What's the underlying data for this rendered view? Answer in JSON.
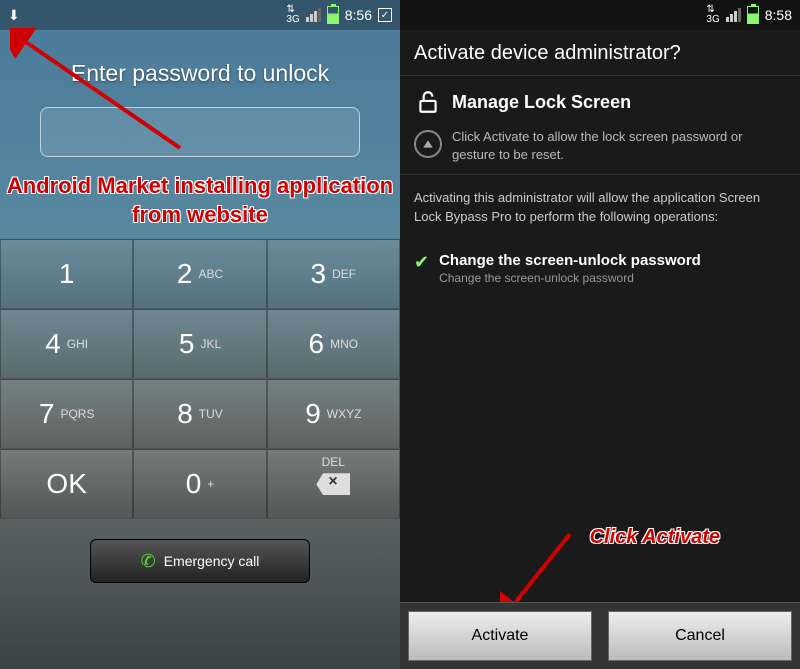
{
  "left": {
    "status": {
      "time": "8:56",
      "network": "3G"
    },
    "prompt": "Enter password to unlock",
    "annotation": "Android Market installing application from website",
    "keys": [
      {
        "n": "1",
        "l": ""
      },
      {
        "n": "2",
        "l": "ABC"
      },
      {
        "n": "3",
        "l": "DEF"
      },
      {
        "n": "4",
        "l": "GHI"
      },
      {
        "n": "5",
        "l": "JKL"
      },
      {
        "n": "6",
        "l": "MNO"
      },
      {
        "n": "7",
        "l": "PQRS"
      },
      {
        "n": "8",
        "l": "TUV"
      },
      {
        "n": "9",
        "l": "WXYZ"
      },
      {
        "n": "OK",
        "l": ""
      },
      {
        "n": "0",
        "l": "+"
      },
      {
        "n": "",
        "l": "DEL",
        "del": true
      }
    ],
    "emergency": "Emergency call"
  },
  "right": {
    "status": {
      "time": "8:58",
      "network": "3G"
    },
    "title": "Activate device administrator?",
    "app_name": "Manage Lock Screen",
    "sub": "Click Activate to allow the lock screen password or gesture to be reset.",
    "body": "Activating this administrator will allow the application Screen Lock Bypass Pro to perform the following operations:",
    "op_title": "Change the screen-unlock password",
    "op_sub": "Change the screen-unlock password",
    "annotation": "Click Activate",
    "activate": "Activate",
    "cancel": "Cancel"
  }
}
